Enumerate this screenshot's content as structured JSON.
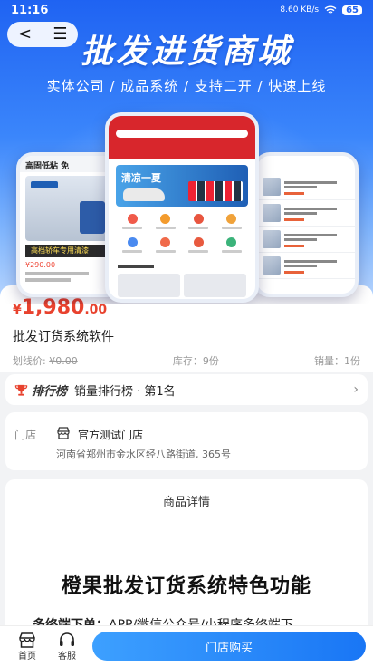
{
  "status_bar": {
    "time": "11:16",
    "network": "8.60 KB/s",
    "battery": "65"
  },
  "nav": {
    "back_label": "<",
    "menu_label": "☰"
  },
  "hero": {
    "title": "批发进货商城",
    "subtitle": "实体公司 / 成品系统 / 支持二开 / 快速上线",
    "left_phone": {
      "headline": "高固低粘 免",
      "bar_text": "高档轿车专用清漆",
      "price": "¥290.00"
    },
    "center_phone": {
      "banner_text": "清凉一夏"
    }
  },
  "product": {
    "price_symbol": "¥",
    "price_integer": "1,980",
    "price_decimal": ".00",
    "name": "批发订货系统软件",
    "list_price_label": "划线价:",
    "list_price": "¥0.00",
    "stock": "库存：9份",
    "sales": "销量：1份"
  },
  "ranking": {
    "brand": "排行榜",
    "text": "销量排行榜 · 第1名",
    "chevron": "›"
  },
  "store": {
    "label": "门店",
    "name": "官方测试门店",
    "address": "河南省郑州市金水区经八路街道, 365号"
  },
  "details": {
    "header": "商品详情",
    "heading": "橙果批发订货系统特色功能",
    "feature_label": "多终端下单：",
    "feature_text": "APP/微信公众号/小程序多终端下"
  },
  "bottom_bar": {
    "home_label": "首页",
    "service_label": "客服",
    "buy_label": "门店购买"
  },
  "colors": {
    "accent": "#1976f5",
    "price": "#e8422e"
  }
}
